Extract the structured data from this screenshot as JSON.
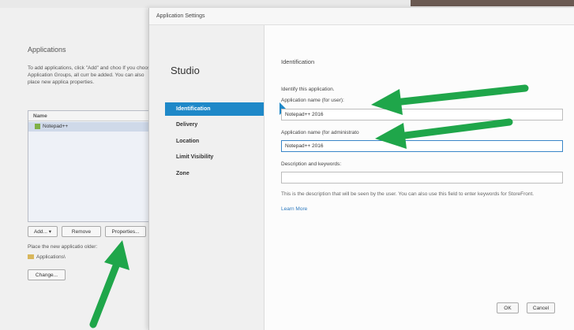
{
  "back_panel": {
    "title": "Applications",
    "description": "To add applications, click \"Add\" and choo If you choose Application Groups, all curr be added. You can also place new applica properties.",
    "list_header": "Name",
    "list_items": [
      "Notepad++"
    ],
    "add_button": "Add...",
    "remove_button": "Remove",
    "properties_button": "Properties...",
    "placement_label": "Place the new applicatio     older:",
    "folder_name": "Applications\\",
    "change_button": "Change..."
  },
  "dialog": {
    "title": "Application Settings",
    "nav_title": "Studio",
    "nav_items": [
      "Identification",
      "Delivery",
      "Location",
      "Limit Visibility",
      "Zone"
    ],
    "section_title": "Identification",
    "intro": "Identify this application.",
    "user_name_label": "Application name (for user):",
    "user_name_value": "Notepad++ 2016",
    "admin_name_label": "Application name (for administrato",
    "admin_name_value": "Notepad++ 2016",
    "description_label": "Description and keywords:",
    "description_value": "",
    "help_text": "This is the description that will be seen by the user. You can also use this field to enter keywords for StoreFront.",
    "learn_more": "Learn More",
    "ok_button": "OK",
    "cancel_button": "Cancel"
  },
  "colors": {
    "accent": "#1e88c8",
    "annotation_arrow": "#1fa64a"
  }
}
